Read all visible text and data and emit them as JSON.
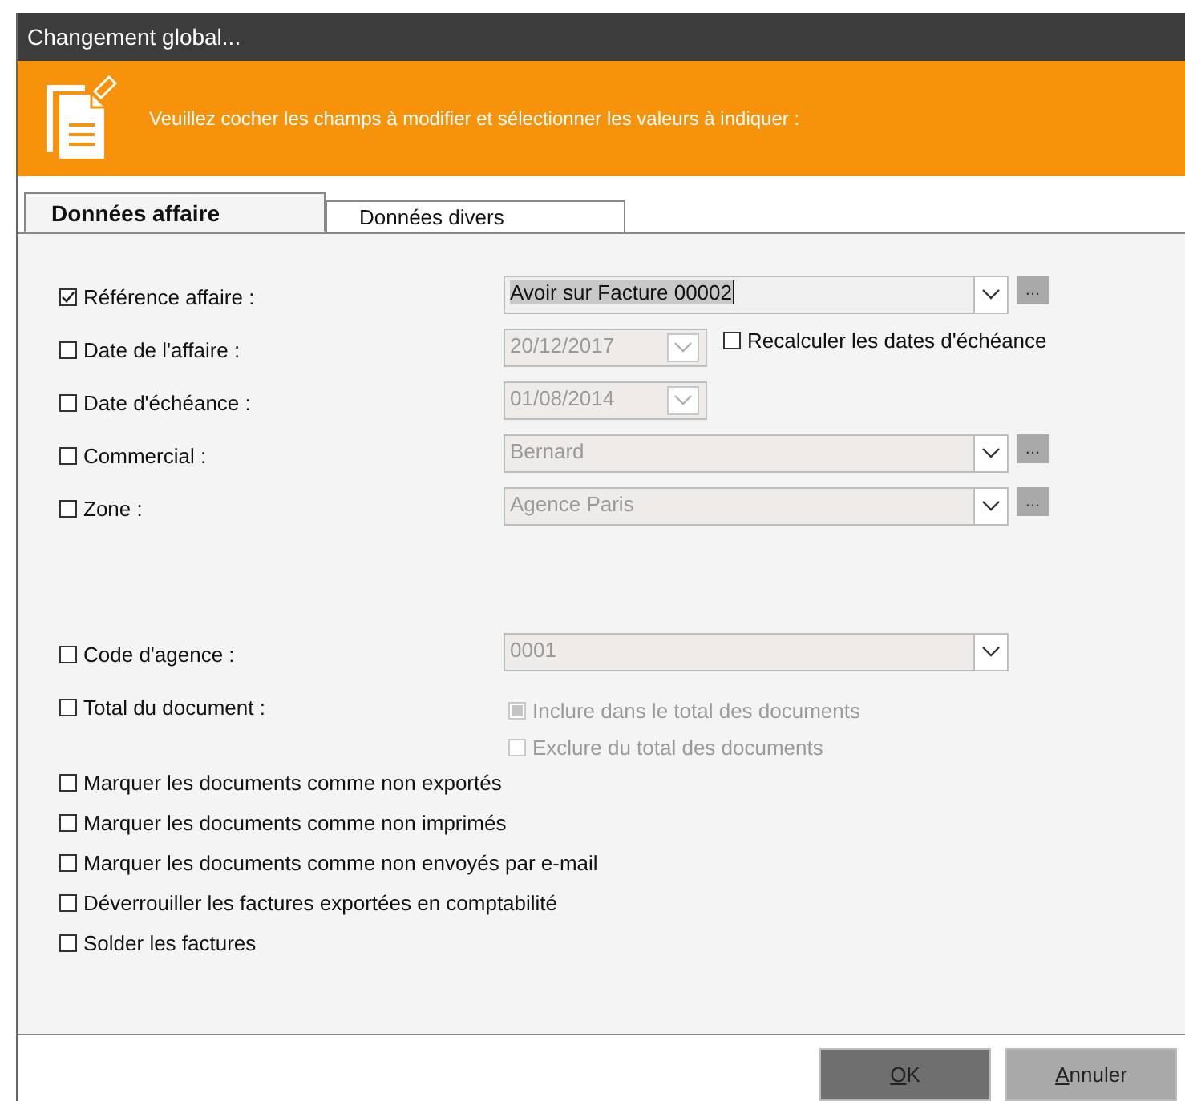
{
  "window": {
    "title": "Changement global..."
  },
  "banner": {
    "text": "Veuillez cocher les champs à modifier et sélectionner les valeurs à indiquer :"
  },
  "tabs": [
    {
      "label": "Données affaire",
      "selected": true
    },
    {
      "label": "Données divers",
      "selected": false
    }
  ],
  "fields": [
    {
      "label": "Référence affaire :",
      "checked": true,
      "kind": "combo",
      "value": "Avoir sur Facture 00002",
      "disabled": false,
      "browse": "..."
    },
    {
      "label": "Date de l'affaire :",
      "checked": false,
      "kind": "date",
      "value": "20/12/2017",
      "disabled": true,
      "option": {
        "label": "Recalculer les dates d'échéance",
        "checked": false
      }
    },
    {
      "label": "Date d'échéance :",
      "checked": false,
      "kind": "date",
      "value": "01/08/2014",
      "disabled": true
    },
    {
      "label": "Commercial :",
      "checked": false,
      "kind": "combo",
      "value": "Bernard",
      "disabled": true,
      "browse": "..."
    },
    {
      "label": "Zone :",
      "checked": false,
      "kind": "combo",
      "value": "Agence Paris",
      "disabled": true,
      "browse": "..."
    }
  ],
  "document_fields": [
    {
      "label": "Code d'agence :",
      "checked": false,
      "kind": "combo",
      "value": "0001",
      "disabled": true
    },
    {
      "label": "Total du document :",
      "checked": false,
      "kind": "choices",
      "options": [
        {
          "label": "Inclure dans le total des documents",
          "checked": true,
          "disabled": true
        },
        {
          "label": "Exclure du total des documents",
          "checked": false,
          "disabled": true
        }
      ]
    }
  ],
  "actions": [
    {
      "label": "Marquer les documents comme non exportés",
      "checked": false
    },
    {
      "label": "Marquer les documents comme non imprimés",
      "checked": false
    },
    {
      "label": "Marquer les documents comme non envoyés par e-mail",
      "checked": false
    },
    {
      "label": "Déverrouiller les factures exportées en comptabilité",
      "checked": false
    },
    {
      "label": "Solder les factures",
      "checked": false
    }
  ],
  "buttons": [
    {
      "label": "OK",
      "default": true
    },
    {
      "label": "Annuler",
      "default": false
    }
  ]
}
